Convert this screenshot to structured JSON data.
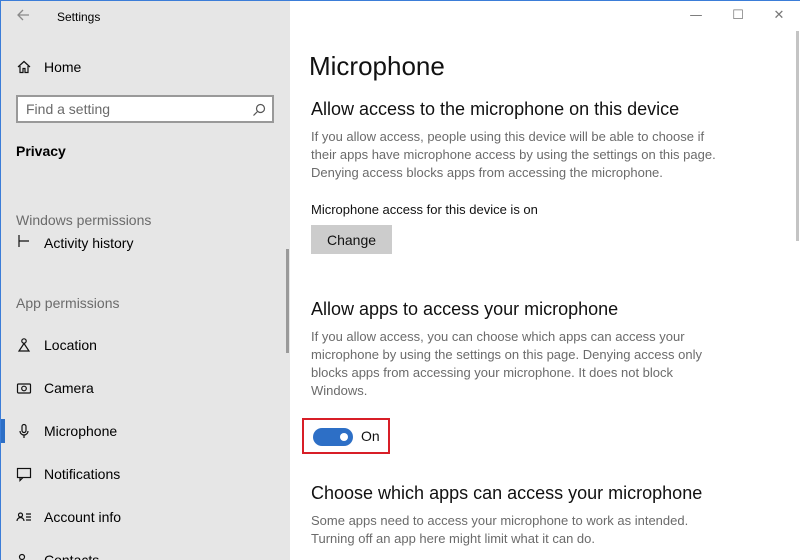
{
  "window": {
    "title": "Settings",
    "controls": [
      "—",
      "☐",
      "✕"
    ]
  },
  "sidebar": {
    "home_label": "Home",
    "search_placeholder": "Find a setting",
    "section_title": "Privacy",
    "windows_permissions_header": "Windows permissions",
    "windows_permissions_items": [
      {
        "label": "Activity history",
        "icon": "activity-history-icon"
      }
    ],
    "app_permissions_header": "App permissions",
    "app_permissions_items": [
      {
        "label": "Location",
        "icon": "location-icon"
      },
      {
        "label": "Camera",
        "icon": "camera-icon"
      },
      {
        "label": "Microphone",
        "icon": "microphone-icon",
        "selected": true
      },
      {
        "label": "Notifications",
        "icon": "notifications-icon"
      },
      {
        "label": "Account info",
        "icon": "account-info-icon"
      },
      {
        "label": "Contacts",
        "icon": "contacts-icon"
      }
    ]
  },
  "main": {
    "page_title": "Microphone",
    "device_section": {
      "heading": "Allow access to the microphone on this device",
      "description": "If you allow access, people using this device will be able to choose if their apps have microphone access by using the settings on this page. Denying access blocks apps from accessing the microphone.",
      "status": "Microphone access for this device is on",
      "button_label": "Change"
    },
    "apps_section": {
      "heading": "Allow apps to access your microphone",
      "description": "If you allow access, you can choose which apps can access your microphone by using the settings on this page. Denying access only blocks apps from accessing your microphone. It does not block Windows.",
      "toggle_state": "On"
    },
    "choose_section": {
      "heading": "Choose which apps can access your microphone",
      "description": "Some apps need to access your microphone to work as intended. Turning off an app here might limit what it can do."
    }
  },
  "colors": {
    "accent": "#2d6fc6",
    "highlight_border": "#d81e27",
    "sidebar_bg": "#e6e6e6"
  }
}
